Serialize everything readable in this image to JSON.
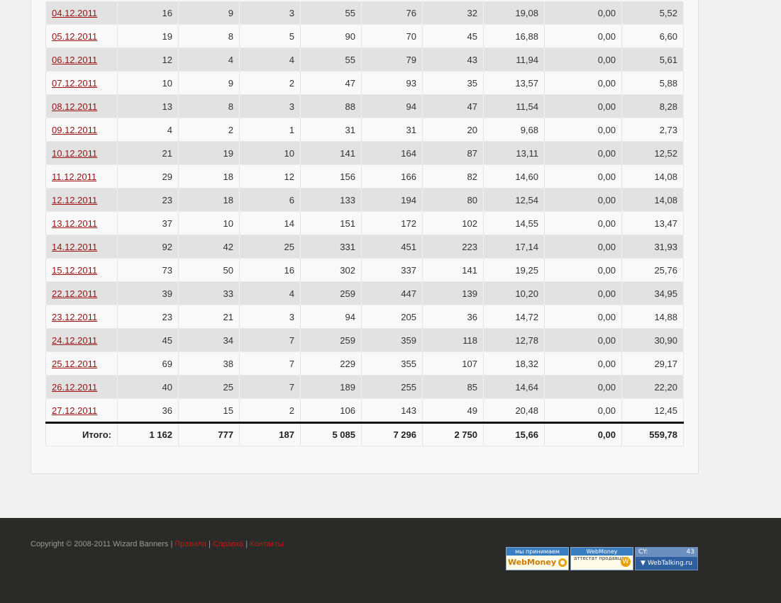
{
  "table": {
    "rows": [
      {
        "date": "04.12.2011",
        "c1": "16",
        "c2": "9",
        "c3": "3",
        "c4": "55",
        "c5": "76",
        "c6": "32",
        "c7": "19,08",
        "c8": "0,00",
        "c9": "5,52"
      },
      {
        "date": "05.12.2011",
        "c1": "19",
        "c2": "8",
        "c3": "5",
        "c4": "90",
        "c5": "70",
        "c6": "45",
        "c7": "16,88",
        "c8": "0,00",
        "c9": "6,60"
      },
      {
        "date": "06.12.2011",
        "c1": "12",
        "c2": "4",
        "c3": "4",
        "c4": "55",
        "c5": "79",
        "c6": "43",
        "c7": "11,94",
        "c8": "0,00",
        "c9": "5,61"
      },
      {
        "date": "07.12.2011",
        "c1": "10",
        "c2": "9",
        "c3": "2",
        "c4": "47",
        "c5": "93",
        "c6": "35",
        "c7": "13,57",
        "c8": "0,00",
        "c9": "5,88"
      },
      {
        "date": "08.12.2011",
        "c1": "13",
        "c2": "8",
        "c3": "3",
        "c4": "88",
        "c5": "94",
        "c6": "47",
        "c7": "11,54",
        "c8": "0,00",
        "c9": "8,28"
      },
      {
        "date": "09.12.2011",
        "c1": "4",
        "c2": "2",
        "c3": "1",
        "c4": "31",
        "c5": "31",
        "c6": "20",
        "c7": "9,68",
        "c8": "0,00",
        "c9": "2,73"
      },
      {
        "date": "10.12.2011",
        "c1": "21",
        "c2": "19",
        "c3": "10",
        "c4": "141",
        "c5": "164",
        "c6": "87",
        "c7": "13,11",
        "c8": "0,00",
        "c9": "12,52"
      },
      {
        "date": "11.12.2011",
        "c1": "29",
        "c2": "18",
        "c3": "12",
        "c4": "156",
        "c5": "166",
        "c6": "82",
        "c7": "14,60",
        "c8": "0,00",
        "c9": "14,08"
      },
      {
        "date": "12.12.2011",
        "c1": "23",
        "c2": "18",
        "c3": "6",
        "c4": "133",
        "c5": "194",
        "c6": "80",
        "c7": "12,54",
        "c8": "0,00",
        "c9": "14,08"
      },
      {
        "date": "13.12.2011",
        "c1": "37",
        "c2": "10",
        "c3": "14",
        "c4": "151",
        "c5": "172",
        "c6": "102",
        "c7": "14,55",
        "c8": "0,00",
        "c9": "13,47"
      },
      {
        "date": "14.12.2011",
        "c1": "92",
        "c2": "42",
        "c3": "25",
        "c4": "331",
        "c5": "451",
        "c6": "223",
        "c7": "17,14",
        "c8": "0,00",
        "c9": "31,93"
      },
      {
        "date": "15.12.2011",
        "c1": "73",
        "c2": "50",
        "c3": "16",
        "c4": "302",
        "c5": "337",
        "c6": "141",
        "c7": "19,25",
        "c8": "0,00",
        "c9": "25,76"
      },
      {
        "date": "22.12.2011",
        "c1": "39",
        "c2": "33",
        "c3": "4",
        "c4": "259",
        "c5": "447",
        "c6": "139",
        "c7": "10,20",
        "c8": "0,00",
        "c9": "34,95"
      },
      {
        "date": "23.12.2011",
        "c1": "23",
        "c2": "21",
        "c3": "3",
        "c4": "94",
        "c5": "205",
        "c6": "36",
        "c7": "14,72",
        "c8": "0,00",
        "c9": "14,88"
      },
      {
        "date": "24.12.2011",
        "c1": "45",
        "c2": "34",
        "c3": "7",
        "c4": "259",
        "c5": "359",
        "c6": "118",
        "c7": "12,78",
        "c8": "0,00",
        "c9": "30,90"
      },
      {
        "date": "25.12.2011",
        "c1": "69",
        "c2": "38",
        "c3": "7",
        "c4": "229",
        "c5": "355",
        "c6": "107",
        "c7": "18,32",
        "c8": "0,00",
        "c9": "29,17"
      },
      {
        "date": "26.12.2011",
        "c1": "40",
        "c2": "25",
        "c3": "7",
        "c4": "189",
        "c5": "255",
        "c6": "85",
        "c7": "14,64",
        "c8": "0,00",
        "c9": "22,20"
      },
      {
        "date": "27.12.2011",
        "c1": "36",
        "c2": "15",
        "c3": "2",
        "c4": "106",
        "c5": "143",
        "c6": "49",
        "c7": "20,48",
        "c8": "0,00",
        "c9": "12,45"
      }
    ],
    "total": {
      "label": "Итого:",
      "c1": "1 162",
      "c2": "777",
      "c3": "187",
      "c4": "5 085",
      "c5": "7 296",
      "c6": "2 750",
      "c7": "15,66",
      "c8": "0,00",
      "c9": "559,78"
    }
  },
  "footer": {
    "copyright": "Copyright © 2008-2011 Wizard Banners",
    "separator": "|",
    "links": [
      "Правила",
      "Справка",
      "Контакты"
    ],
    "badges": {
      "webmoney_accept_top": "мы принимаем",
      "webmoney_accept_bottom": "WebMoney",
      "webmoney_attest_top": "WebMoney",
      "webmoney_attest_bottom": "аттестат продавца",
      "webtalking_label": "CY:",
      "webtalking_value": "43",
      "webtalking_site": "WebTalking.ru"
    }
  },
  "colors": {
    "link": "#9a1010",
    "footer_link": "#cc1111",
    "footer_bg": "#2a2a28",
    "row_odd": "#e2e2e2",
    "row_even": "#f9f9f9"
  }
}
